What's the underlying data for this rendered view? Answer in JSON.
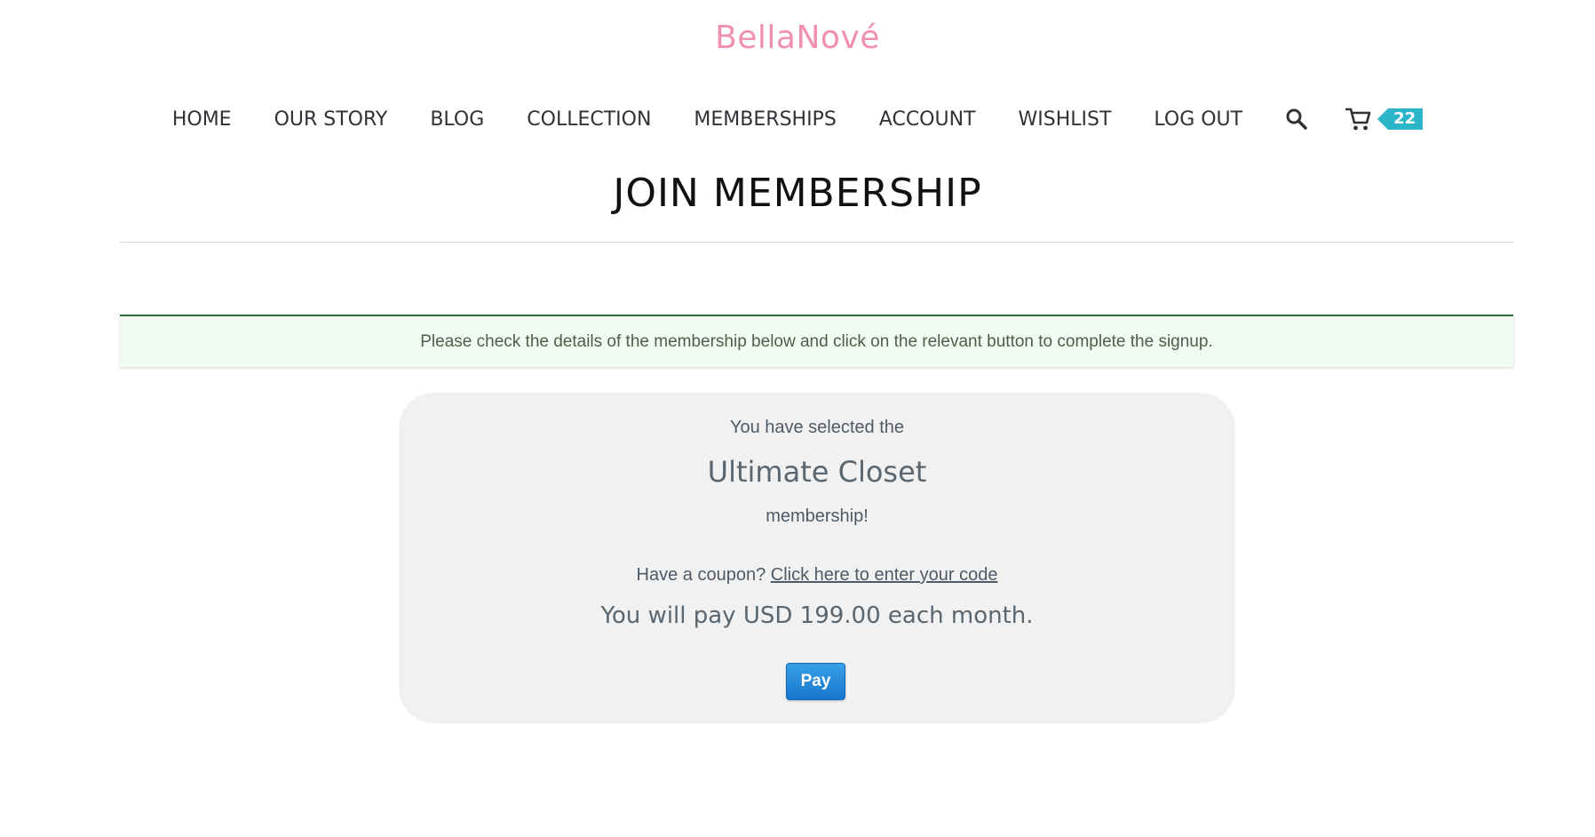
{
  "brand": {
    "logo_text": "BellaNové",
    "color": "#f08fb3"
  },
  "nav": {
    "items": [
      {
        "label": "HOME"
      },
      {
        "label": "OUR STORY"
      },
      {
        "label": "BLOG"
      },
      {
        "label": "COLLECTION"
      },
      {
        "label": "MEMBERSHIPS"
      },
      {
        "label": "ACCOUNT"
      },
      {
        "label": "WISHLIST"
      },
      {
        "label": "LOG OUT"
      }
    ],
    "search_icon": "search-icon",
    "cart_icon": "cart-icon",
    "cart_count": "22",
    "badge_color": "#2bb5c9"
  },
  "page": {
    "title": "JOIN MEMBERSHIP"
  },
  "notice": {
    "text": "Please check the details of the membership below and click on the relevant button to complete the signup.",
    "border_color": "#2f6b3a",
    "background": "#f2fbf1"
  },
  "membership": {
    "selected_prefix": "You have selected the",
    "plan_name": "Ultimate Closet",
    "selected_suffix": "membership!",
    "coupon_prompt": "Have a coupon?",
    "coupon_link": "Click here to enter your code",
    "pay_text": "You will pay USD 199.00 each month.",
    "pay_button": "Pay",
    "button_color": "#1f87d8"
  }
}
